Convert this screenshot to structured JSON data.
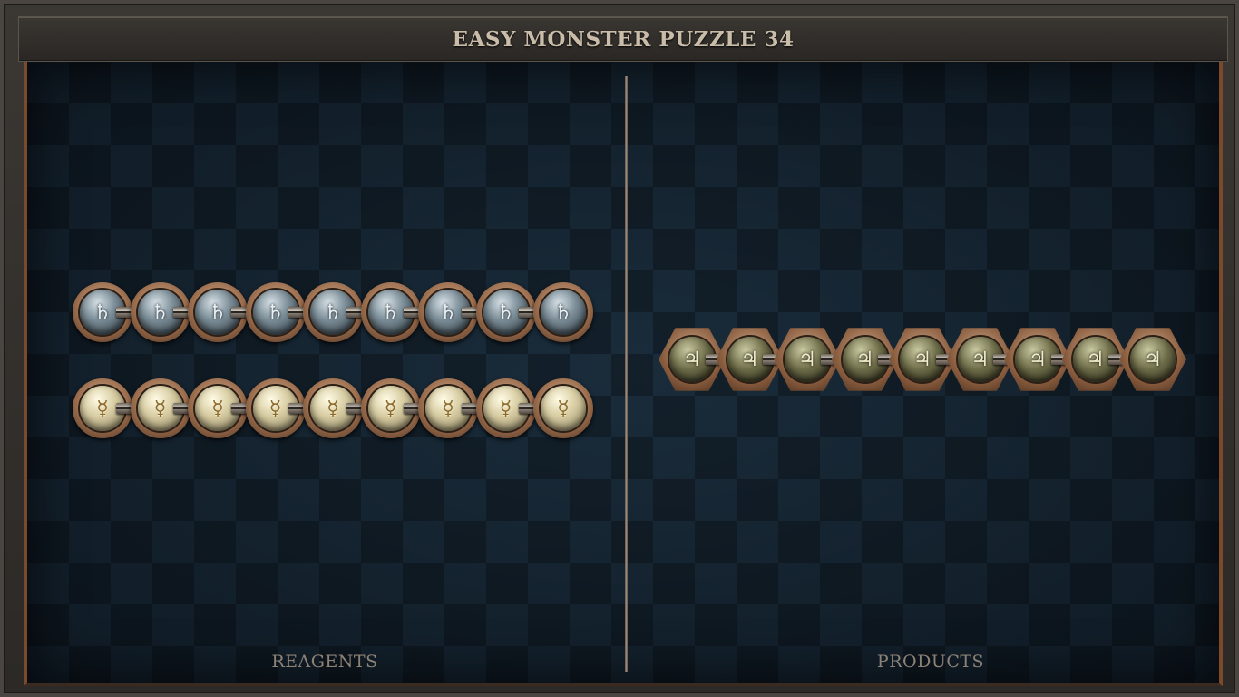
{
  "title": "EASY MONSTER PUZZLE 34",
  "reagents": {
    "label": "REAGENTS",
    "molecules": [
      {
        "element": "saturn",
        "glyph": "♄",
        "atom_count": 9
      },
      {
        "element": "mercury",
        "glyph": "☿",
        "atom_count": 9
      }
    ]
  },
  "products": {
    "label": "PRODUCTS",
    "molecules": [
      {
        "element": "jupiter",
        "glyph": "♃",
        "atom_count": 9
      }
    ]
  },
  "colors": {
    "board": "#13212d",
    "frame": "#2c2926",
    "copper_edge": "#7a4a2a",
    "title_text": "#c9bca8",
    "label_text": "#8d8276"
  }
}
